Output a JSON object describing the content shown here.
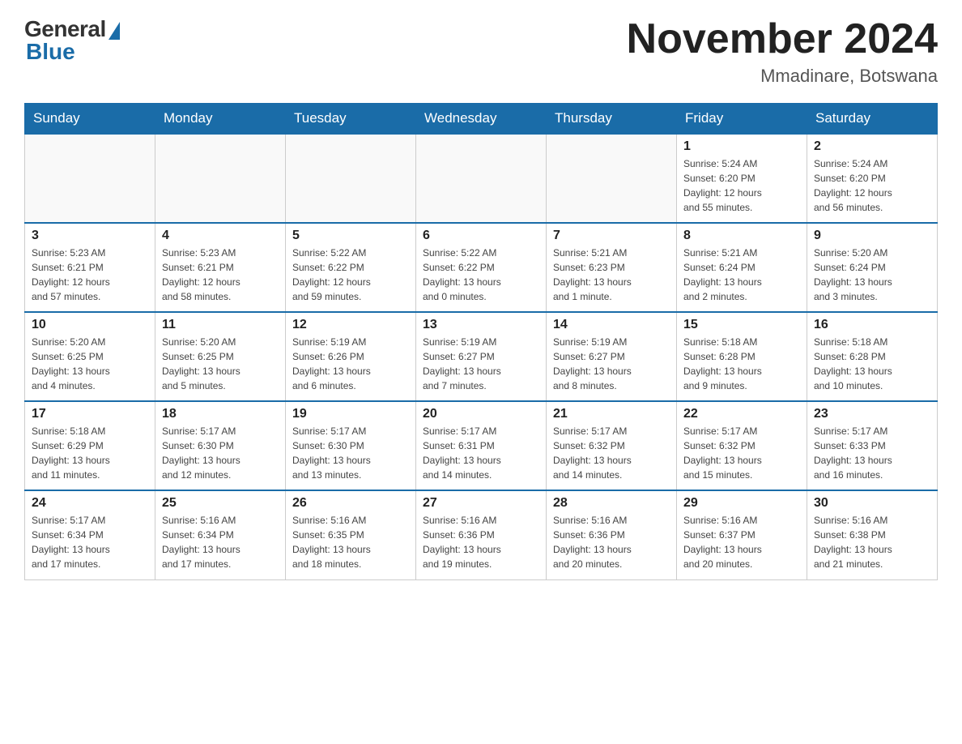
{
  "header": {
    "logo_general": "General",
    "logo_blue": "Blue",
    "month_title": "November 2024",
    "location": "Mmadinare, Botswana"
  },
  "weekdays": [
    "Sunday",
    "Monday",
    "Tuesday",
    "Wednesday",
    "Thursday",
    "Friday",
    "Saturday"
  ],
  "weeks": [
    {
      "days": [
        {
          "num": "",
          "info": "",
          "empty": true
        },
        {
          "num": "",
          "info": "",
          "empty": true
        },
        {
          "num": "",
          "info": "",
          "empty": true
        },
        {
          "num": "",
          "info": "",
          "empty": true
        },
        {
          "num": "",
          "info": "",
          "empty": true
        },
        {
          "num": "1",
          "info": "Sunrise: 5:24 AM\nSunset: 6:20 PM\nDaylight: 12 hours\nand 55 minutes."
        },
        {
          "num": "2",
          "info": "Sunrise: 5:24 AM\nSunset: 6:20 PM\nDaylight: 12 hours\nand 56 minutes."
        }
      ]
    },
    {
      "days": [
        {
          "num": "3",
          "info": "Sunrise: 5:23 AM\nSunset: 6:21 PM\nDaylight: 12 hours\nand 57 minutes."
        },
        {
          "num": "4",
          "info": "Sunrise: 5:23 AM\nSunset: 6:21 PM\nDaylight: 12 hours\nand 58 minutes."
        },
        {
          "num": "5",
          "info": "Sunrise: 5:22 AM\nSunset: 6:22 PM\nDaylight: 12 hours\nand 59 minutes."
        },
        {
          "num": "6",
          "info": "Sunrise: 5:22 AM\nSunset: 6:22 PM\nDaylight: 13 hours\nand 0 minutes."
        },
        {
          "num": "7",
          "info": "Sunrise: 5:21 AM\nSunset: 6:23 PM\nDaylight: 13 hours\nand 1 minute."
        },
        {
          "num": "8",
          "info": "Sunrise: 5:21 AM\nSunset: 6:24 PM\nDaylight: 13 hours\nand 2 minutes."
        },
        {
          "num": "9",
          "info": "Sunrise: 5:20 AM\nSunset: 6:24 PM\nDaylight: 13 hours\nand 3 minutes."
        }
      ]
    },
    {
      "days": [
        {
          "num": "10",
          "info": "Sunrise: 5:20 AM\nSunset: 6:25 PM\nDaylight: 13 hours\nand 4 minutes."
        },
        {
          "num": "11",
          "info": "Sunrise: 5:20 AM\nSunset: 6:25 PM\nDaylight: 13 hours\nand 5 minutes."
        },
        {
          "num": "12",
          "info": "Sunrise: 5:19 AM\nSunset: 6:26 PM\nDaylight: 13 hours\nand 6 minutes."
        },
        {
          "num": "13",
          "info": "Sunrise: 5:19 AM\nSunset: 6:27 PM\nDaylight: 13 hours\nand 7 minutes."
        },
        {
          "num": "14",
          "info": "Sunrise: 5:19 AM\nSunset: 6:27 PM\nDaylight: 13 hours\nand 8 minutes."
        },
        {
          "num": "15",
          "info": "Sunrise: 5:18 AM\nSunset: 6:28 PM\nDaylight: 13 hours\nand 9 minutes."
        },
        {
          "num": "16",
          "info": "Sunrise: 5:18 AM\nSunset: 6:28 PM\nDaylight: 13 hours\nand 10 minutes."
        }
      ]
    },
    {
      "days": [
        {
          "num": "17",
          "info": "Sunrise: 5:18 AM\nSunset: 6:29 PM\nDaylight: 13 hours\nand 11 minutes."
        },
        {
          "num": "18",
          "info": "Sunrise: 5:17 AM\nSunset: 6:30 PM\nDaylight: 13 hours\nand 12 minutes."
        },
        {
          "num": "19",
          "info": "Sunrise: 5:17 AM\nSunset: 6:30 PM\nDaylight: 13 hours\nand 13 minutes."
        },
        {
          "num": "20",
          "info": "Sunrise: 5:17 AM\nSunset: 6:31 PM\nDaylight: 13 hours\nand 14 minutes."
        },
        {
          "num": "21",
          "info": "Sunrise: 5:17 AM\nSunset: 6:32 PM\nDaylight: 13 hours\nand 14 minutes."
        },
        {
          "num": "22",
          "info": "Sunrise: 5:17 AM\nSunset: 6:32 PM\nDaylight: 13 hours\nand 15 minutes."
        },
        {
          "num": "23",
          "info": "Sunrise: 5:17 AM\nSunset: 6:33 PM\nDaylight: 13 hours\nand 16 minutes."
        }
      ]
    },
    {
      "days": [
        {
          "num": "24",
          "info": "Sunrise: 5:17 AM\nSunset: 6:34 PM\nDaylight: 13 hours\nand 17 minutes."
        },
        {
          "num": "25",
          "info": "Sunrise: 5:16 AM\nSunset: 6:34 PM\nDaylight: 13 hours\nand 17 minutes."
        },
        {
          "num": "26",
          "info": "Sunrise: 5:16 AM\nSunset: 6:35 PM\nDaylight: 13 hours\nand 18 minutes."
        },
        {
          "num": "27",
          "info": "Sunrise: 5:16 AM\nSunset: 6:36 PM\nDaylight: 13 hours\nand 19 minutes."
        },
        {
          "num": "28",
          "info": "Sunrise: 5:16 AM\nSunset: 6:36 PM\nDaylight: 13 hours\nand 20 minutes."
        },
        {
          "num": "29",
          "info": "Sunrise: 5:16 AM\nSunset: 6:37 PM\nDaylight: 13 hours\nand 20 minutes."
        },
        {
          "num": "30",
          "info": "Sunrise: 5:16 AM\nSunset: 6:38 PM\nDaylight: 13 hours\nand 21 minutes."
        }
      ]
    }
  ]
}
